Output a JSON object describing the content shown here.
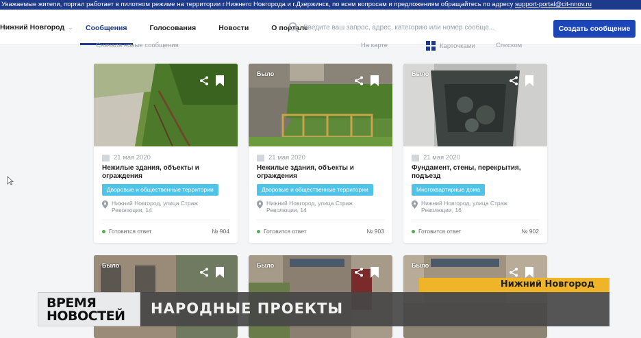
{
  "banner": {
    "text": "Уважаемые жители, портал работает в пилотном режиме на территории г.Нижнего Новгорода и г.Дзержинск, по всем вопросам и предложениям обращайтесь по адресу ",
    "email": "support-portal@cit-nnov.ru"
  },
  "header": {
    "city": "Нижний Новгород",
    "nav": [
      "Сообщения",
      "Голосования",
      "Новости",
      "О портале"
    ],
    "search_placeholder": "Введите ваш запрос, адрес, категорию или номер сообще...",
    "create_button": "Создать сообщение"
  },
  "toolbar": {
    "sort": "Сначала новые сообщения",
    "view_map": "На карте",
    "view_cards": "Карточками",
    "view_list": "Списком"
  },
  "cards": [
    {
      "was_label": "",
      "date": "21 мая 2020",
      "category": "Нежилые здания, объекты и ограждения",
      "tag": "Дворовые и общественные территории",
      "address": [
        "Нижний Новгород, улица Страж",
        "Революции, 14"
      ],
      "status": "Готовится ответ",
      "number": "№ 904"
    },
    {
      "was_label": "Было",
      "date": "21 мая 2020",
      "category": "Нежилые здания, объекты и ограждения",
      "tag": "Дворовые и общественные территории",
      "address": [
        "Нижний Новгород, улица Страж",
        "Революции, 14"
      ],
      "status": "Готовится ответ",
      "number": "№ 903"
    },
    {
      "was_label": "Было",
      "date": "21 мая 2020",
      "category": "Фундамент, стены, перекрытия, подъезд",
      "tag": "Многоквартирные дома",
      "address": [
        "Нижний Новгород, улица Страж",
        "Революции, 16"
      ],
      "status": "Готовится ответ",
      "number": "№ 902"
    }
  ],
  "lower_cards": [
    {
      "was_label": "Было"
    },
    {
      "was_label": "Было"
    },
    {
      "was_label": "Было"
    }
  ],
  "tv": {
    "logo_line1": "ВРЕМЯ",
    "logo_line2": "НОВОСТЕЙ",
    "title": "НАРОДНЫЕ ПРОЕКТЫ",
    "location": "Нижний Новгород"
  },
  "colors": {
    "brand": "#1e3a8a",
    "primary_button": "#1c45b8",
    "tag": "#4fc3e8",
    "status_dot": "#4caf50",
    "tv_location": "#f0b429"
  }
}
